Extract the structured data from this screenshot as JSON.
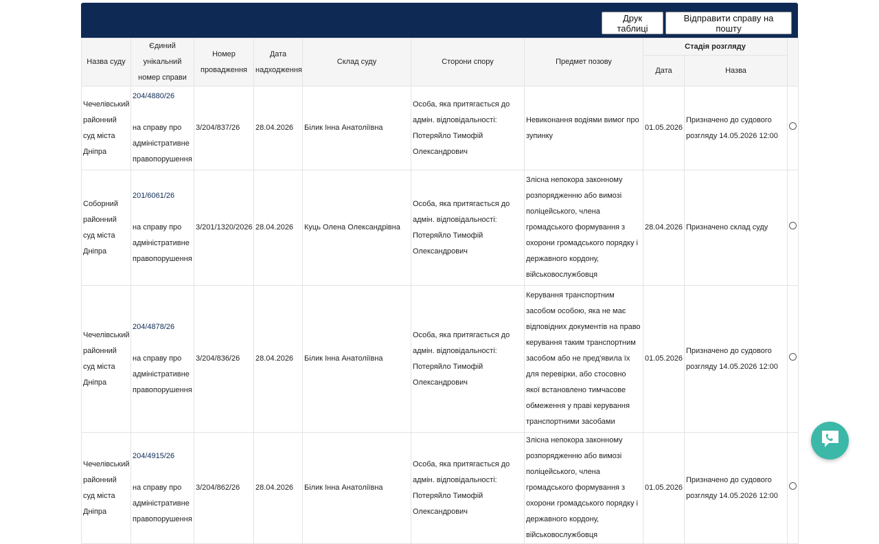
{
  "toolbar": {
    "print_label": "Друк таблиці",
    "mail_label": "Відправити справу на пошту"
  },
  "headers": {
    "court": "Назва суду",
    "case_number": "Єдиний унікальний номер справи",
    "proceeding": "Номер провадження",
    "received": "Дата надходження",
    "composition": "Склад суду",
    "parties": "Сторони спору",
    "subject": "Предмет позову",
    "stage_group": "Стадія розгляду",
    "stage_date": "Дата",
    "stage_name": "Назва"
  },
  "rows": [
    {
      "court": "Чечелівський районний суд міста Дніпра",
      "case_link": "204/4880/26",
      "case_type": "на справу про адміністративне правопорушення",
      "proceeding": "3/204/837/26",
      "received": "28.04.2026",
      "composition": "Білик Інна Анатоліївна",
      "parties": "Особа, яка притягається до адмін. відповідальності: Потеряйло Тимофій Олександрович",
      "subject": "Невиконання водіями вимог про зупинку",
      "stage_date": "01.05.2026",
      "stage_name": "Призначено до судового розгляду 14.05.2026 12:00"
    },
    {
      "court": "Соборний районний суд міста Дніпра",
      "case_link": "201/6061/26",
      "case_type": "на справу про адміністративне правопорушення",
      "proceeding": "3/201/1320/2026",
      "received": "28.04.2026",
      "composition": "Куць Олена Олександрівна",
      "parties": "Особа, яка притягається до адмін. відповідальності: Потеряйло Тимофій Олександрович",
      "subject": "Злісна непокора законному розпорядженню або вимозі поліцейського, члена громадського формування з охорони громадського порядку і державного кордону, військовослужбовця",
      "stage_date": "28.04.2026",
      "stage_name": "Призначено склад суду"
    },
    {
      "court": "Чечелівський районний суд міста Дніпра",
      "case_link": "204/4878/26",
      "case_type": "на справу про адміністративне правопорушення",
      "proceeding": "3/204/836/26",
      "received": "28.04.2026",
      "composition": "Білик Інна Анатоліївна",
      "parties": "Особа, яка притягається до адмін. відповідальності: Потеряйло Тимофій Олександрович",
      "subject": "Керування транспортним засобом особою, яка не має відповідних документів на право керування таким транспортним засобом або не пред'явила їх для перевірки, або стосовно якої встановлено тимчасове обмеження у праві керування транспортними засобами",
      "stage_date": "01.05.2026",
      "stage_name": "Призначено до судового розгляду 14.05.2026 12:00"
    },
    {
      "court": "Чечелівський районний суд міста Дніпра",
      "case_link": "204/4915/26",
      "case_type": "на справу про адміністративне правопорушення",
      "proceeding": "3/204/862/26",
      "received": "28.04.2026",
      "composition": "Білик Інна Анатоліївна",
      "parties": "Особа, яка притягається до адмін. відповідальності: Потеряйло Тимофій Олександрович",
      "subject": "Злісна непокора законному розпорядженню або вимозі поліцейського, члена громадського формування з охорони громадського порядку і державного кордону, військовослужбовця",
      "stage_date": "01.05.2026",
      "stage_name": "Призначено до судового розгляду 14.05.2026 12:00"
    }
  ]
}
